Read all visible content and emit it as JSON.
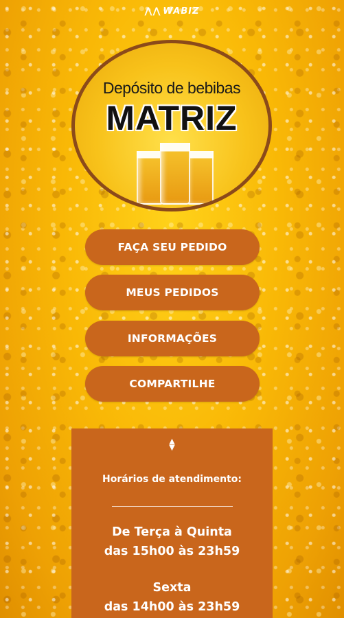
{
  "brand": {
    "name": "WABIZ"
  },
  "logo": {
    "subtitle": "Depósito de bebibas",
    "title": "MATRIZ"
  },
  "menu": {
    "order": "FAÇA SEU PEDIDO",
    "my_orders": "MEUS PEDIDOS",
    "info": "INFORMAÇÕES",
    "share": "COMPARTILHE"
  },
  "info_panel": {
    "hours_title": "Horários de atendimento:",
    "schedule": [
      {
        "days": "De Terça à Quinta",
        "time": "das 15h00 às 23h59"
      },
      {
        "days": "Sexta",
        "time": "das 14h00 às 23h59"
      }
    ]
  },
  "colors": {
    "button": "#c9661c",
    "background": "#f9b806",
    "logo_border": "#8b4a1a"
  }
}
